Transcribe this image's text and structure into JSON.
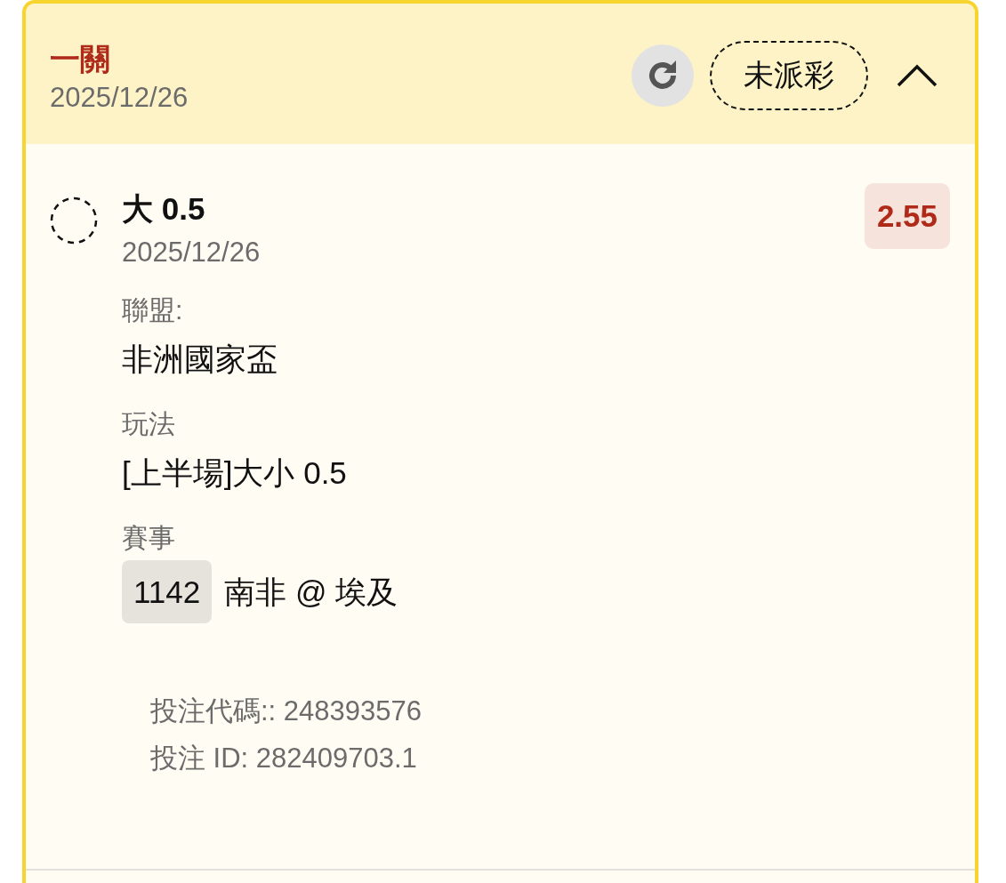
{
  "header": {
    "title": "一關",
    "date": "2025/12/26",
    "status": "未派彩",
    "expanded": true
  },
  "selection": {
    "checked": false,
    "name": "大 0.5",
    "date": "2025/12/26",
    "odds": "2.55"
  },
  "fields": [
    {
      "kind": "text",
      "label": "聯盟:",
      "value": "非洲國家盃"
    },
    {
      "kind": "text",
      "label": "玩法",
      "value": "[上半場]大小 0.5"
    },
    {
      "kind": "match",
      "label": "賽事",
      "code": "1142",
      "value": "南非 @ 埃及"
    }
  ],
  "footer": [
    "投注代碼:: 248393576",
    "投注 ID: 282409703.1"
  ]
}
